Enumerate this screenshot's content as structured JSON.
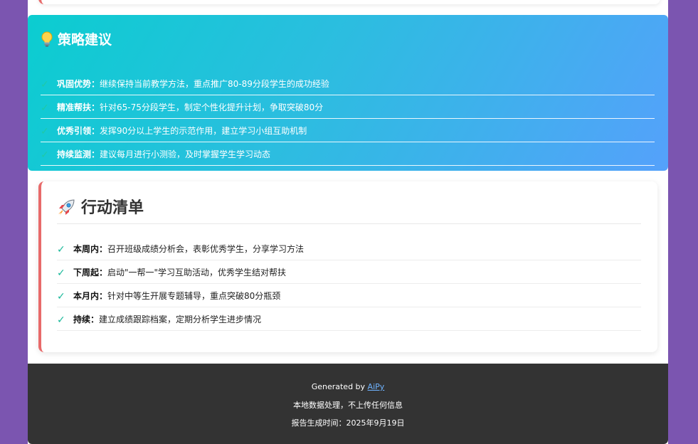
{
  "strategy": {
    "icon": "lightbulb-icon",
    "title": "策略建议",
    "items": [
      {
        "label": "巩固优势：",
        "text": "继续保持当前教学方法，重点推广80-89分段学生的成功经验"
      },
      {
        "label": "精准帮扶：",
        "text": "针对65-75分段学生，制定个性化提升计划，争取突破80分"
      },
      {
        "label": "优秀引领：",
        "text": "发挥90分以上学生的示范作用，建立学习小组互助机制"
      },
      {
        "label": "持续监测：",
        "text": "建议每月进行小测验，及时掌握学生学习动态"
      }
    ]
  },
  "action": {
    "icon": "rocket-icon",
    "title": "行动清单",
    "items": [
      {
        "label": "本周内：",
        "text": "召开班级成绩分析会，表彰优秀学生，分享学习方法"
      },
      {
        "label": "下周起：",
        "text": "启动\"一帮一\"学习互助活动，优秀学生结对帮扶"
      },
      {
        "label": "本月内：",
        "text": "针对中等生开展专题辅导，重点突破80分瓶颈"
      },
      {
        "label": "持续：",
        "text": "建立成绩跟踪档案，定期分析学生进步情况"
      }
    ]
  },
  "footer": {
    "generated_prefix": "Generated by ",
    "generator_link": "AiPy",
    "privacy_note": "本地数据处理，不上传任何信息",
    "report_time": "报告生成时间：2025年9月19日"
  },
  "colors": {
    "background": "#7b55b0",
    "strategy_gradient_start": "#0bcdd0",
    "strategy_gradient_end": "#55a1fb",
    "accent_border": "#e86a6a",
    "check": "#19b89a",
    "footer_bg": "#333333",
    "link": "#6fb3ff"
  }
}
